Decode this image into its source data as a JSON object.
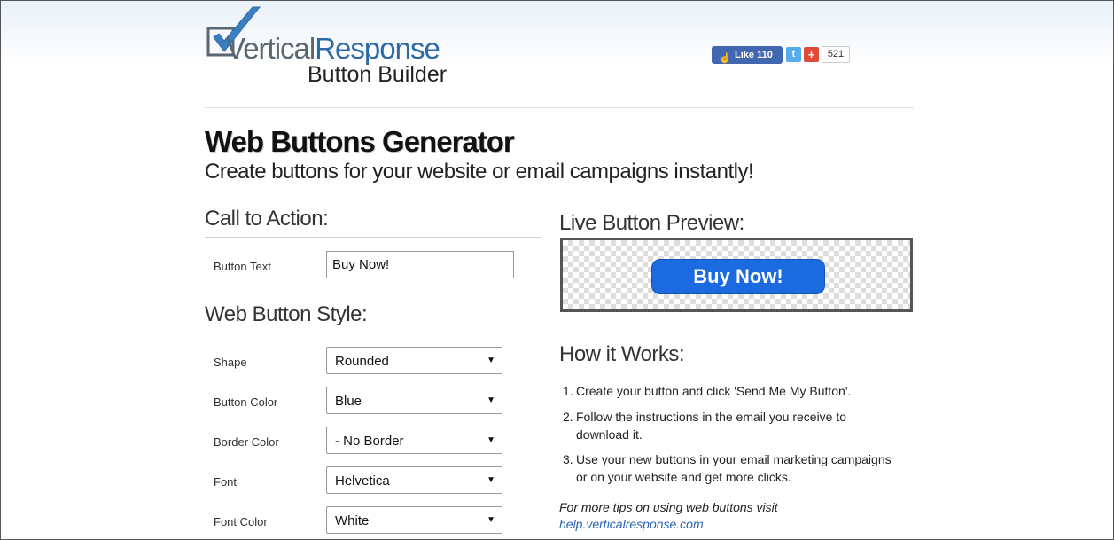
{
  "brand": {
    "wordmark_part1": "Vertical",
    "wordmark_part2": "Response",
    "subtitle": "Button Builder"
  },
  "social": {
    "fb_like": "Like 110",
    "twitter_icon": "twitter-icon",
    "gplus_icon": "google-plus-icon",
    "gplus_count": "521"
  },
  "header": {
    "title": "Web Buttons Generator",
    "subtitle": "Create buttons for your website or email campaigns instantly!"
  },
  "cta": {
    "heading": "Call to Action:",
    "button_text_label": "Button Text",
    "button_text_value": "Buy Now!"
  },
  "style": {
    "heading": "Web Button Style:",
    "fields": [
      {
        "label": "Shape",
        "value": "Rounded"
      },
      {
        "label": "Button Color",
        "value": "Blue"
      },
      {
        "label": "Border Color",
        "value": "- No Border"
      },
      {
        "label": "Font",
        "value": "Helvetica"
      },
      {
        "label": "Font Color",
        "value": "White"
      }
    ]
  },
  "preview": {
    "heading": "Live Button Preview:",
    "button_label": "Buy Now!",
    "button_color": "#1b6ae0"
  },
  "how": {
    "heading": "How it Works:",
    "steps": [
      "Create your button and click 'Send Me My Button'.",
      "Follow the instructions in the email you receive to download it.",
      "Use your new buttons in your email marketing campaigns or on your website and get more clicks."
    ],
    "tips": "For more tips on using web buttons visit",
    "link": "help.verticalresponse.com"
  }
}
